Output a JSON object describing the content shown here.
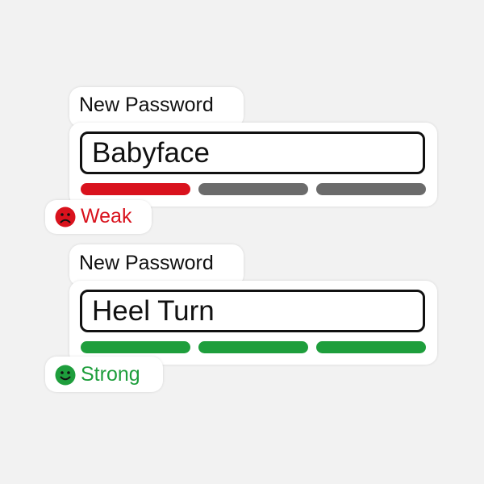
{
  "colors": {
    "weak": "#d9121d",
    "strong": "#1e9e3c",
    "empty": "#6b6b6b",
    "background": "#f2f2f2"
  },
  "forms": [
    {
      "label": "New Password",
      "value": "Babyface",
      "strength": {
        "filled_segments": 1,
        "total_segments": 3,
        "status": "Weak",
        "icon": "sad-face-icon"
      }
    },
    {
      "label": "New Password",
      "value": "Heel Turn",
      "strength": {
        "filled_segments": 3,
        "total_segments": 3,
        "status": "Strong",
        "icon": "happy-face-icon"
      }
    }
  ]
}
